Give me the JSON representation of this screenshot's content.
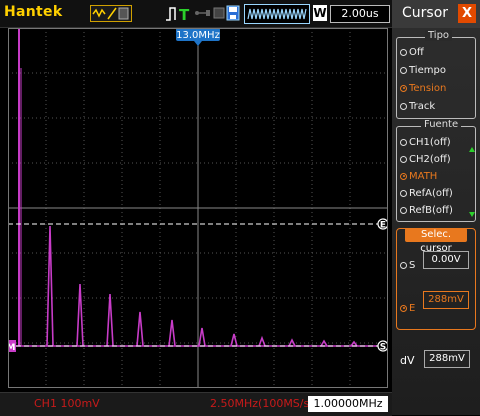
{
  "topbar": {
    "brand": "Hantek",
    "trigger_status": "T",
    "timebase_waveform_icon": "waveform-icon",
    "window_label": "W",
    "timebase": "2.00us"
  },
  "plot": {
    "freq_marker": "13.0MHz",
    "cursor_e_label": "E",
    "cursor_s_label": "S",
    "ch_marker": "M"
  },
  "bottom": {
    "ch1": "CH1  100mV",
    "sample": "2.50MHz(100MS/s)",
    "trigger_freq": "1.00000MHz"
  },
  "panel": {
    "title": "Cursor",
    "close": "X",
    "tipo": {
      "title": "Tipo",
      "options": [
        "Off",
        "Tiempo",
        "Tension",
        "Track"
      ],
      "selected": "Tension"
    },
    "fuente": {
      "title": "Fuente",
      "options": [
        "CH1(off)",
        "CH2(off)",
        "MATH",
        "RefA(off)",
        "RefB(off)"
      ],
      "selected": "MATH"
    },
    "select": {
      "title": "Selec. cursor",
      "s_label": "S",
      "s_value": "0.00V",
      "e_label": "E",
      "e_value": "288mV",
      "selected": "E"
    },
    "dv_label": "dV",
    "dv_value": "288mV"
  },
  "colors": {
    "trace": "#c83cc8",
    "accent": "#e8781e",
    "brand": "#ffd000",
    "status_red": "#c81a1a"
  }
}
